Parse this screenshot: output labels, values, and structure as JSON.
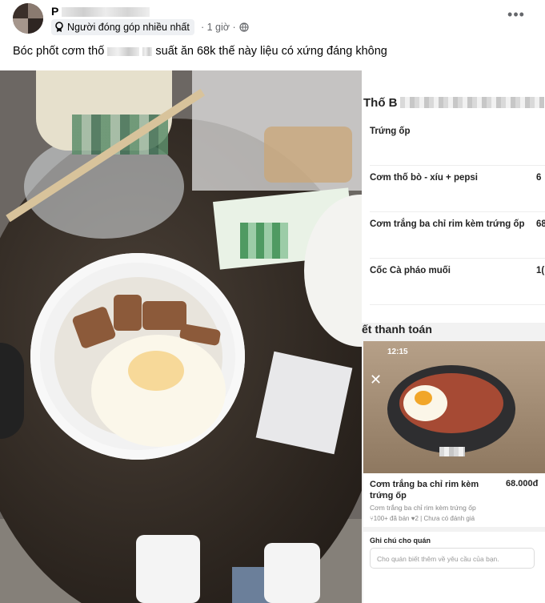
{
  "post": {
    "author_prefix": "P",
    "badge": "Người đóng góp nhiều nhất",
    "time": "· 1 giờ ·",
    "more_label": "•••",
    "caption_part1": "Bóc phốt cơm thố",
    "caption_part2": "suất ăn 68k thế này liệu có xứng đáng không"
  },
  "menu": {
    "store_name_prefix": "Thố B",
    "items": [
      {
        "name": "Trứng ốp",
        "price": ""
      },
      {
        "name": "Cơm thố bò - xíu + pepsi",
        "price": "6"
      },
      {
        "name": "Cơm trắng ba chỉ rim kèm trứng ốp",
        "price": "68"
      },
      {
        "name": "Cốc Cà pháo muối",
        "price": "1("
      }
    ],
    "payment_title": "ết thanh toán"
  },
  "detail": {
    "status_time": "12:15",
    "close": "✕",
    "title": "Cơm trắng ba chỉ rim kèm trứng ốp",
    "price": "68.000đ",
    "subtitle": "Cơm trắng ba chỉ rim kèm trứng ốp",
    "stats": "⑂100+ đã bán  ♥2  |  Chưa có đánh giá",
    "note_label": "Ghi chú cho quán",
    "note_placeholder": "Cho quán biết thêm về yêu cầu của bạn."
  }
}
